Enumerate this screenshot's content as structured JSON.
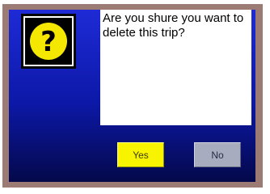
{
  "dialog": {
    "icon": "question-mark-icon",
    "icon_glyph": "?",
    "message": "Are you shure you want to delete this trip?",
    "yes_label": "Yes",
    "no_label": "No"
  },
  "colors": {
    "frame": "#9b7b73",
    "background_top": "#1e2bd6",
    "background_bottom": "#04084a",
    "icon_circle": "#f5e800",
    "yes_button": "#f8f400",
    "no_button": "#a8acbf"
  }
}
